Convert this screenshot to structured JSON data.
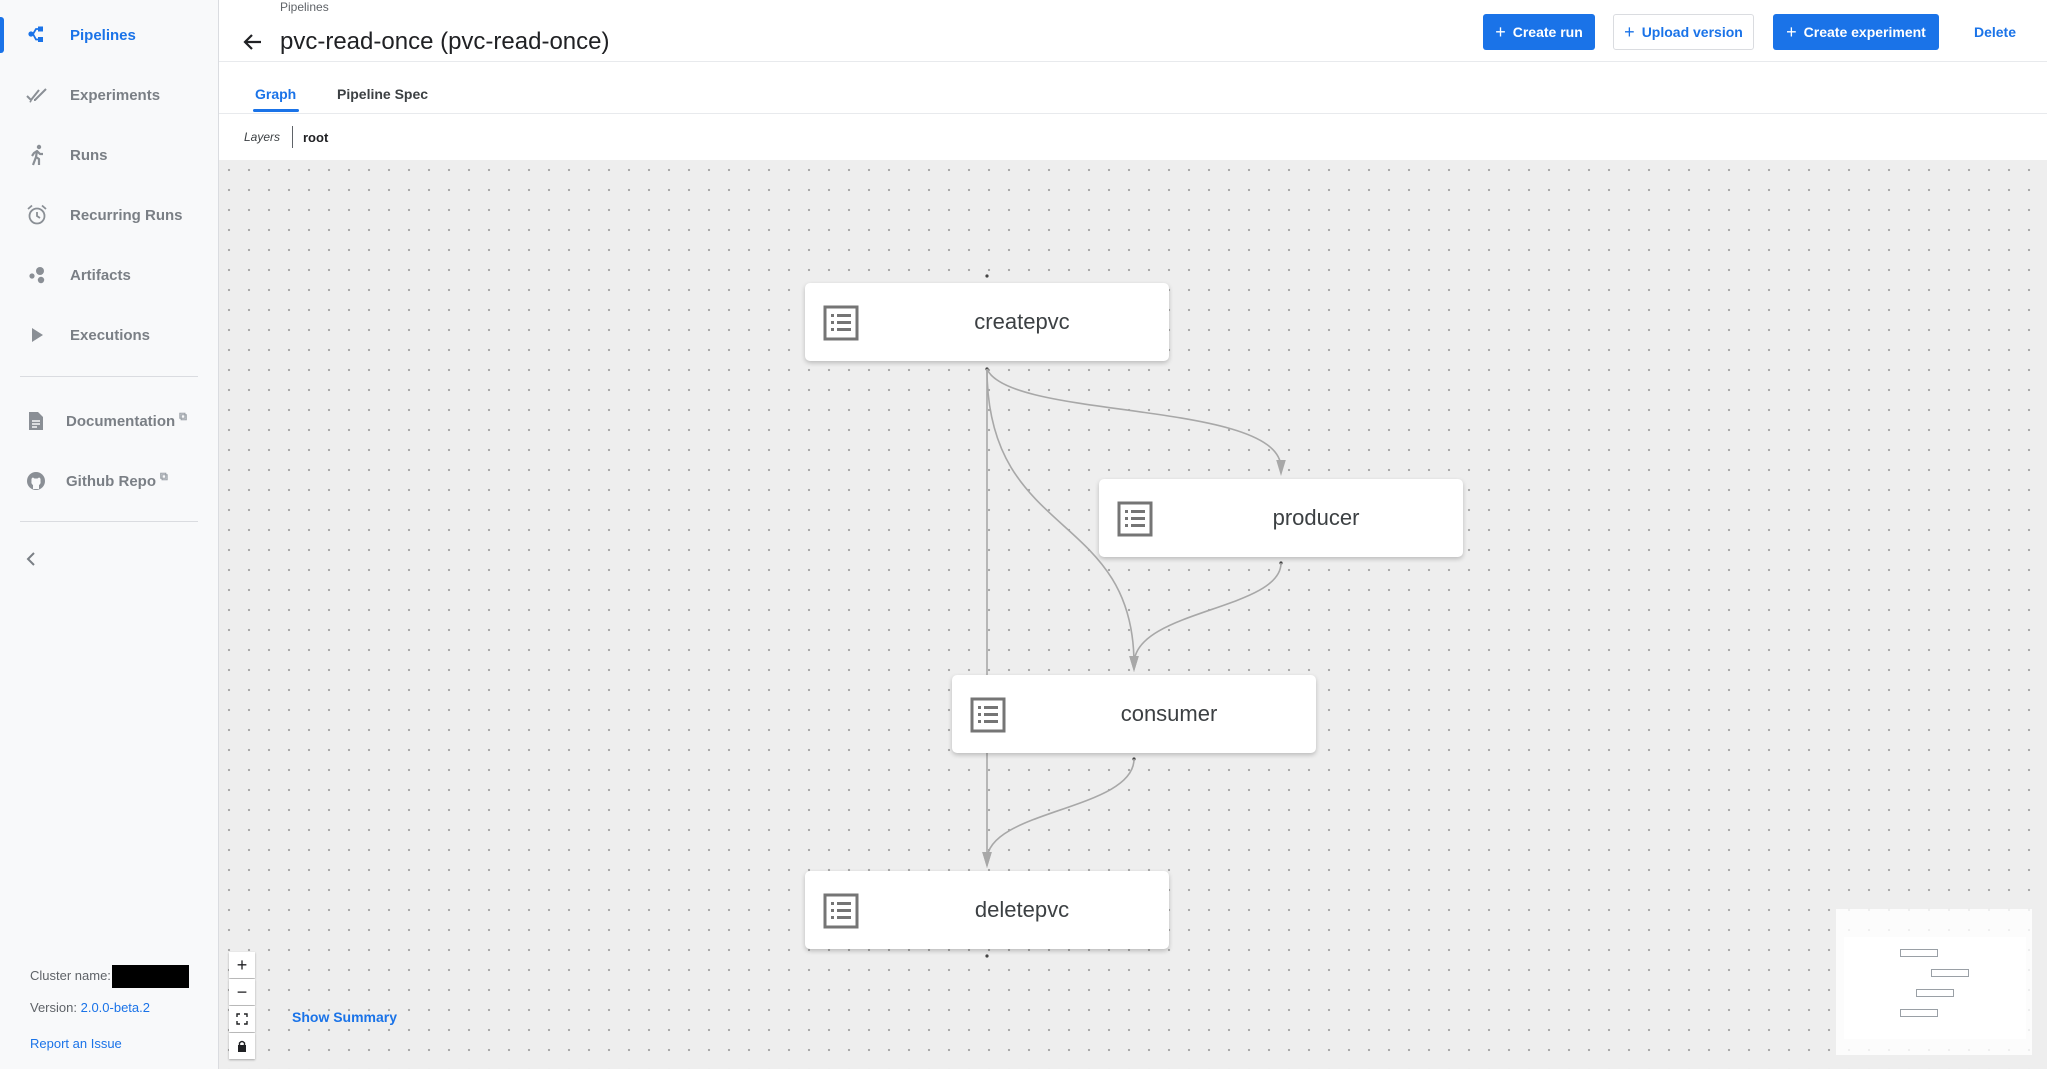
{
  "sidebar": {
    "items": [
      {
        "label": "Pipelines",
        "icon": "pipelines-icon",
        "active": true
      },
      {
        "label": "Experiments",
        "icon": "experiments-icon"
      },
      {
        "label": "Runs",
        "icon": "runs-icon"
      },
      {
        "label": "Recurring Runs",
        "icon": "alarm-clock-icon"
      },
      {
        "label": "Artifacts",
        "icon": "artifacts-icon"
      },
      {
        "label": "Executions",
        "icon": "play-icon"
      }
    ],
    "links": [
      {
        "label": "Documentation",
        "icon": "document-icon"
      },
      {
        "label": "Github Repo",
        "icon": "github-icon"
      }
    ],
    "footer": {
      "cluster_label": "Cluster name:",
      "version_label": "Version:",
      "version_value": "2.0.0-beta.2",
      "report_issue": "Report an Issue"
    }
  },
  "header": {
    "breadcrumb": "Pipelines",
    "title": "pvc-read-once (pvc-read-once)",
    "buttons": {
      "create_run": "Create run",
      "upload_version": "Upload version",
      "create_experiment": "Create experiment",
      "delete": "Delete"
    }
  },
  "tabs": [
    {
      "label": "Graph",
      "active": true
    },
    {
      "label": "Pipeline Spec"
    }
  ],
  "layers": {
    "label": "Layers",
    "value": "root"
  },
  "graph": {
    "nodes": [
      {
        "id": "createpvc",
        "label": "createpvc"
      },
      {
        "id": "producer",
        "label": "producer"
      },
      {
        "id": "consumer",
        "label": "consumer"
      },
      {
        "id": "deletepvc",
        "label": "deletepvc"
      }
    ],
    "edges": [
      [
        "createpvc",
        "producer"
      ],
      [
        "createpvc",
        "consumer"
      ],
      [
        "createpvc",
        "deletepvc"
      ],
      [
        "producer",
        "consumer"
      ],
      [
        "consumer",
        "deletepvc"
      ]
    ],
    "show_summary": "Show Summary",
    "zoom_controls": {
      "zoom_in": "+",
      "zoom_out": "−"
    },
    "colors": {
      "accent": "#1a73e8",
      "canvas": "#eeeeee",
      "edge": "#a8a8a8"
    }
  }
}
